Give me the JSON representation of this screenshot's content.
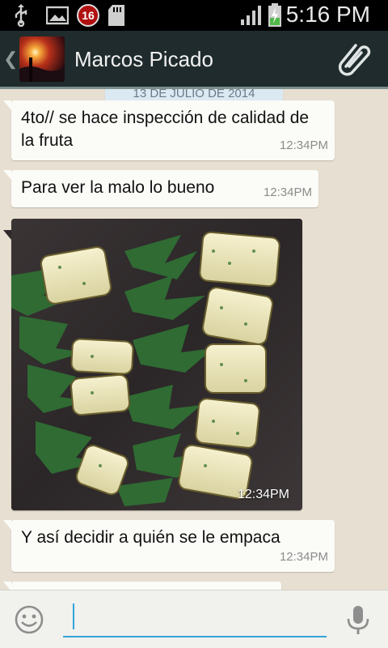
{
  "status_bar": {
    "notification_count": "16",
    "time": "5:16 PM",
    "icons": [
      "usb-icon",
      "gallery-icon",
      "notification-count-badge",
      "sd-card-icon",
      "signal-icon",
      "battery-charging-icon"
    ]
  },
  "header": {
    "contact_name": "Marcos Picado",
    "attach_icon": "paperclip-icon",
    "back_icon": "chevron-left-icon"
  },
  "chat": {
    "date_divider": "13 DE JULIO DE 2014",
    "messages": [
      {
        "type": "text",
        "text": "4to// se hace inspección de calidad de la fruta",
        "time": "12:34PM"
      },
      {
        "type": "text",
        "text": "Para ver la malo lo bueno",
        "time": "12:34PM"
      },
      {
        "type": "image",
        "time": "12:34PM"
      },
      {
        "type": "text",
        "text": "Y así decidir a quién se le empaca",
        "time": "12:34PM"
      }
    ]
  },
  "input_bar": {
    "value": "",
    "emoji_icon": "smiley-icon",
    "mic_icon": "microphone-icon"
  },
  "colors": {
    "header_bg": "#1f2b2c",
    "chat_bg": "#e7dfd1",
    "bubble_bg": "#fbfbf8",
    "input_underline": "#33a4d8"
  }
}
